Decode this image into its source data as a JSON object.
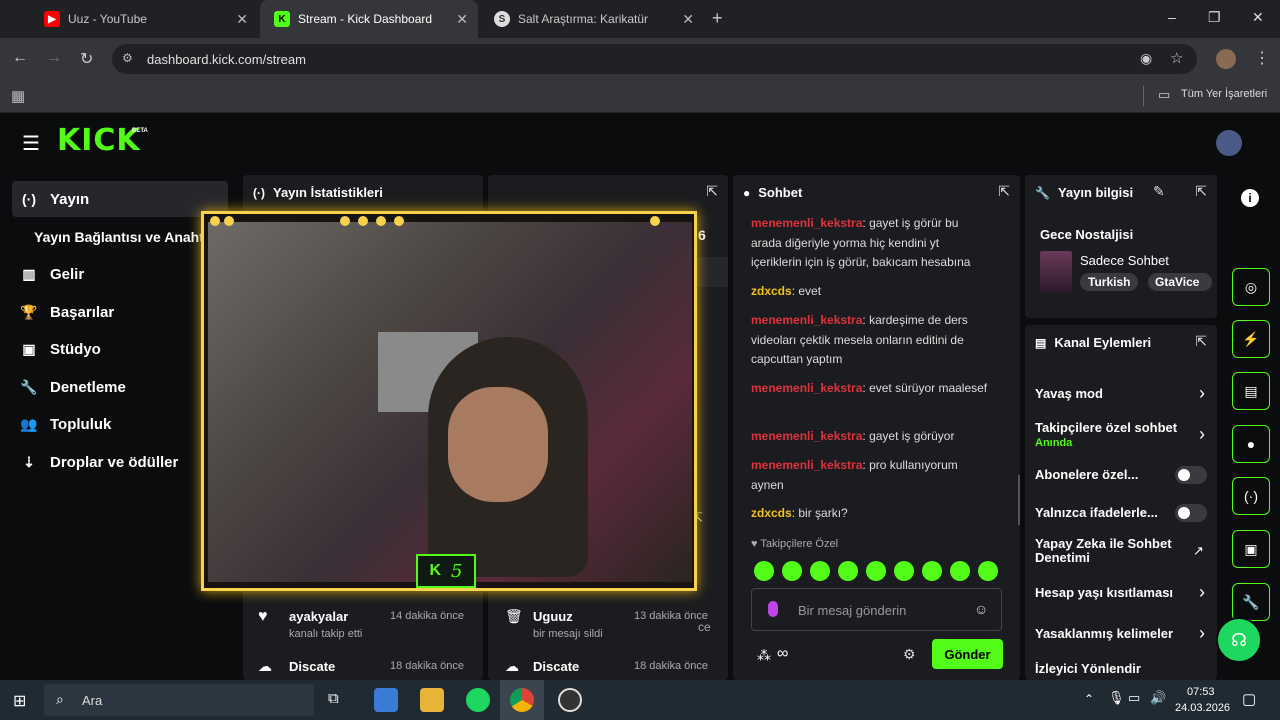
{
  "browser": {
    "tabs": [
      {
        "title": "Uuz - YouTube",
        "icon": "youtube-icon"
      },
      {
        "title": "Stream - Kick Dashboard",
        "icon": "kick-icon",
        "active": true
      },
      {
        "title": "Salt Araştırma: Karikatür",
        "icon": "salt-icon"
      }
    ],
    "new_tab": "+",
    "url": "dashboard.kick.com/stream",
    "bookmarks_label": "Tüm Yer İşaretleri",
    "win_min": "–",
    "win_max": "❐",
    "win_close": "✕"
  },
  "header": {
    "logo": "KICK",
    "beta": "BETA"
  },
  "sidebar": {
    "items": [
      {
        "label": "Yayın",
        "icon": "broadcast-icon",
        "glyph": "(·)"
      },
      {
        "label": "Yayın Bağlantısı ve Anahtar",
        "icon": "",
        "glyph": ""
      },
      {
        "label": "Gelir",
        "icon": "revenue-icon",
        "glyph": "▥"
      },
      {
        "label": "Başarılar",
        "icon": "trophy-icon",
        "glyph": "🏆"
      },
      {
        "label": "Stüdyo",
        "icon": "studio-icon",
        "glyph": "▣"
      },
      {
        "label": "Denetleme",
        "icon": "wrench-icon",
        "glyph": "🔧"
      },
      {
        "label": "Topluluk",
        "icon": "community-icon",
        "glyph": "👥"
      },
      {
        "label": "Droplar ve ödüller",
        "icon": "drops-icon",
        "glyph": "⇣"
      }
    ]
  },
  "stats": {
    "title": "Yayın İstatistikleri",
    "value_fragment": "6",
    "activity_partial": "ce",
    "activity": [
      {
        "name": "ayakyalar",
        "time": "14 dakika önce",
        "desc": "kanalı takip etti"
      },
      {
        "name": "Uguuz",
        "time": "13 dakika önce",
        "desc": "bir mesajı sildi"
      },
      {
        "name": "Discate",
        "time": "18 dakika önce",
        "desc": ""
      },
      {
        "name": "Discate",
        "time": "18 dakika önce",
        "desc": ""
      }
    ]
  },
  "webcam": {
    "badge_letter": "K",
    "badge_number": "5"
  },
  "chat": {
    "title": "Sohbet",
    "messages": [
      {
        "user": "menemenli_kekstra",
        "text": "gayet iş görür bu arada diğeriyle yorma hiç kendini yt içeriklerin için iş görür, bakıcam hesabına",
        "color": "red"
      },
      {
        "user": "zdxcds",
        "text": "evet",
        "color": "yellow"
      },
      {
        "user": "menemenli_kekstra",
        "text": "kardeşime de ders videoları çektik mesela onların editini de capcuttan yaptım",
        "color": "red"
      },
      {
        "user": "menemenli_kekstra",
        "text": "evet sürüyor maalesef",
        "color": "red"
      },
      {
        "user": "menemenli_kekstra",
        "text": "gayet iş görüyor",
        "color": "red"
      },
      {
        "user": "menemenli_kekstra",
        "text": "pro kullanıyorum aynen",
        "color": "red"
      },
      {
        "user": "zdxcds",
        "text": "bir şarkı?",
        "color": "yellow"
      }
    ],
    "followers_only": "Takipçilere Özel",
    "placeholder": "Bir mesaj gönderin",
    "send": "Gönder",
    "infinity": "∞"
  },
  "stream_info": {
    "title": "Yayın bilgisi",
    "stream_title": "Gece Nostaljisi",
    "category": "Sadece Sohbet",
    "tags": [
      "Turkish",
      "GtaVice"
    ]
  },
  "channel_actions": {
    "title": "Kanal Eylemleri",
    "items": [
      {
        "label": "Yavaş mod",
        "type": "chevron"
      },
      {
        "label": "Takipçilere özel sohbet",
        "sub": "Anında",
        "type": "chevron"
      },
      {
        "label": "Abonelere özel...",
        "type": "toggle"
      },
      {
        "label": "Yalnızca ifadelerle...",
        "type": "toggle"
      },
      {
        "label": "Yapay Zeka ile Sohbet Denetimi",
        "type": "external"
      },
      {
        "label": "Hesap yaşı kısıtlaması",
        "type": "chevron"
      },
      {
        "label": "Yasaklanmış kelimeler",
        "type": "chevron"
      },
      {
        "label": "İzleyici Yönlendir",
        "type": "none"
      }
    ]
  },
  "taskbar": {
    "search": "Ara",
    "time": "07:53",
    "date": "24.03.2026"
  },
  "colors": {
    "accent": "#53fc18",
    "chat_red": "#e0323c",
    "chat_yellow": "#f3c21b",
    "bg": "#0b0c0e",
    "panel": "#1b1c1f"
  }
}
